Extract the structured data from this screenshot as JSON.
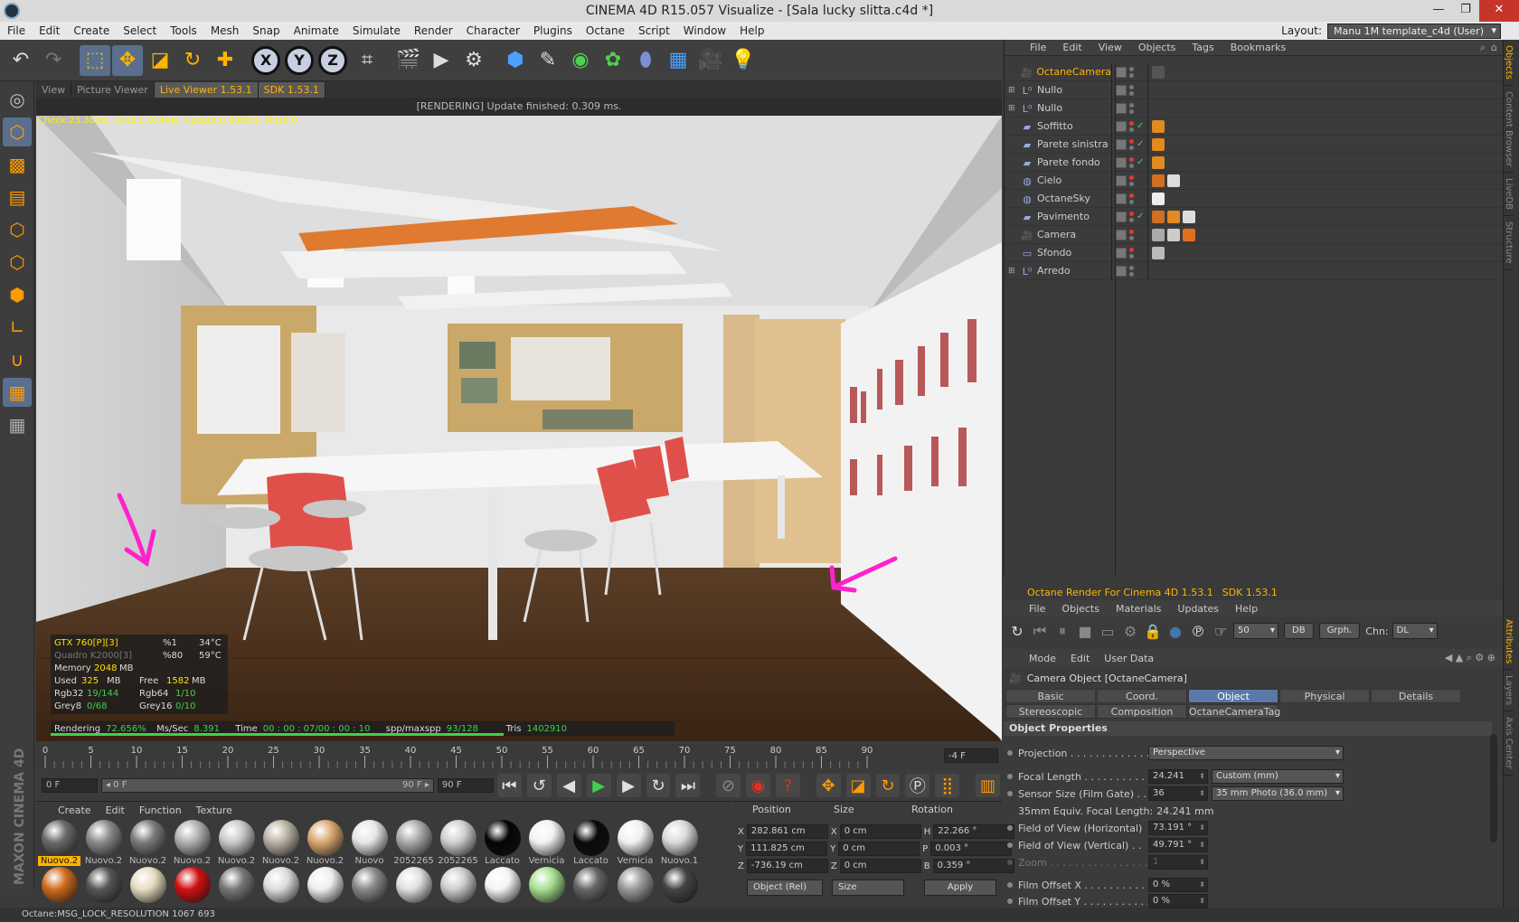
{
  "window": {
    "title": "CINEMA 4D R15.057 Visualize - [Sala lucky slitta.c4d *]",
    "min": "—",
    "restore": "❐",
    "close": "✕"
  },
  "menu": [
    "File",
    "Edit",
    "Create",
    "Select",
    "Tools",
    "Mesh",
    "Snap",
    "Animate",
    "Simulate",
    "Render",
    "Character",
    "Plugins",
    "Octane",
    "Script",
    "Window",
    "Help"
  ],
  "layout": {
    "label": "Layout:",
    "value": "Manu 1M template_c4d (User)"
  },
  "viewport": {
    "tabs": [
      "View",
      "Picture Viewer",
      "Live Viewer 1.53.1",
      "SDK 1.53.1"
    ],
    "status": "[RENDERING] Update finished: 0.309 ms.",
    "stats_line": "Check:23.38ms. Data:0.034ms. Update:0.309ms. Mesh:0",
    "gpu": {
      "gpu1": "GTX 760[P][3]",
      "gpu1_pct": "%1",
      "gpu1_temp": "34°C",
      "gpu2": "Quadro K2000[3]",
      "gpu2_pct": "%80",
      "gpu2_temp": "59°C",
      "memory_label": "Memory",
      "memory": "2048",
      "mb": "MB",
      "used_label": "Used",
      "used": "325",
      "free_label": "Free",
      "free": "1582",
      "rgb32_label": "Rgb32",
      "rgb32": "19/144",
      "rgb64_label": "Rgb64",
      "rgb64": "1/10",
      "grey8_label": "Grey8",
      "grey8": "0/68",
      "grey16_label": "Grey16",
      "grey16": "0/10"
    },
    "render": {
      "label": "Rendering",
      "pct": "72.656%",
      "mss_label": "Ms/Sec",
      "mss": "8.391",
      "time_label": "Time",
      "time": "00 : 00 : 07/00 : 00 : 10",
      "spp_label": "spp/maxspp",
      "spp": "93/128",
      "tris_label": "Tris",
      "tris": "1402910",
      "progress": 0.72656
    }
  },
  "timeline": {
    "ticks": [
      "0",
      "5",
      "10",
      "15",
      "20",
      "25",
      "30",
      "35",
      "40",
      "45",
      "50",
      "55",
      "60",
      "65",
      "70",
      "75",
      "80",
      "85",
      "90"
    ],
    "frame": "-4 F"
  },
  "transport": {
    "start": "0 F",
    "range_start": "◂ 0 F",
    "range_end": "90 F ▸",
    "end": "90 F"
  },
  "materials": {
    "menu": [
      "Create",
      "Edit",
      "Function",
      "Texture"
    ],
    "items": [
      {
        "label": "Nuovo.2",
        "color": "#6a6a6a"
      },
      {
        "label": "Nuovo.2",
        "color": "#8a8a8a"
      },
      {
        "label": "Nuovo.2",
        "color": "#7a7a7a"
      },
      {
        "label": "Nuovo.2",
        "color": "#b0b0b0"
      },
      {
        "label": "Nuovo.2",
        "color": "#c8c8c8"
      },
      {
        "label": "Nuovo.2",
        "color": "#b9b2a5"
      },
      {
        "label": "Nuovo.2",
        "color": "#d9a870"
      },
      {
        "label": "Nuovo",
        "color": "#e6e6e6"
      },
      {
        "label": "2052265",
        "color": "#a9a9a9"
      },
      {
        "label": "2052265",
        "color": "#cfcfcf"
      },
      {
        "label": "Laccato",
        "color": "#050505"
      },
      {
        "label": "Vernicia",
        "color": "#f2f2f2"
      },
      {
        "label": "Laccato",
        "color": "#0a0a0a"
      },
      {
        "label": "Vernicia",
        "color": "#f0f0f0"
      },
      {
        "label": "Nuovo.1",
        "color": "#dadada"
      },
      {
        "label": "",
        "color": "#d06a1a"
      },
      {
        "label": "",
        "color": "#555"
      },
      {
        "label": "",
        "color": "#e6dcc0"
      },
      {
        "label": "",
        "color": "#d01010"
      },
      {
        "label": "",
        "color": "#777"
      },
      {
        "label": "",
        "color": "#ddd"
      },
      {
        "label": "",
        "color": "#eee"
      },
      {
        "label": "",
        "color": "#888"
      },
      {
        "label": "",
        "color": "#e0e0e0"
      },
      {
        "label": "",
        "color": "#ccc"
      },
      {
        "label": "",
        "color": "#f4f4f4"
      },
      {
        "label": "",
        "color": "#a6e090"
      },
      {
        "label": "",
        "color": "#666"
      },
      {
        "label": "",
        "color": "#999"
      },
      {
        "label": "",
        "color": "#444"
      }
    ]
  },
  "coords": {
    "headers": {
      "position": "Position",
      "size": "Size",
      "rotation": "Rotation"
    },
    "rows": [
      {
        "axis": "X",
        "pos": "282.861 cm",
        "saxis": "X",
        "size": "0 cm",
        "raxis": "H",
        "rot": "22.266 °"
      },
      {
        "axis": "Y",
        "pos": "111.825 cm",
        "saxis": "Y",
        "size": "0 cm",
        "raxis": "P",
        "rot": "0.003 °"
      },
      {
        "axis": "Z",
        "pos": "-736.19 cm",
        "saxis": "Z",
        "size": "0 cm",
        "raxis": "B",
        "rot": "0.359 °"
      }
    ],
    "mode": "Object (Rel)",
    "size_mode": "Size",
    "apply": "Apply"
  },
  "statusbar": "Octane:MSG_LOCK_RESOLUTION 1067 693",
  "objects": {
    "menu": [
      "File",
      "Edit",
      "View",
      "Objects",
      "Tags",
      "Bookmarks"
    ],
    "items": [
      {
        "name": "OctaneCamera",
        "icon": "camera-icon",
        "sel": true,
        "expand": "",
        "check": ""
      },
      {
        "name": "Nullo",
        "icon": "null-icon",
        "expand": "⊞",
        "check": ""
      },
      {
        "name": "Nullo",
        "icon": "null-icon",
        "expand": "⊞",
        "check": ""
      },
      {
        "name": "Soffitto",
        "icon": "plane-icon",
        "expand": "",
        "check": "✓"
      },
      {
        "name": "Parete sinistra",
        "icon": "plane-icon",
        "expand": "",
        "check": "✓"
      },
      {
        "name": "Parete fondo",
        "icon": "plane-icon",
        "expand": "",
        "check": "✓"
      },
      {
        "name": "Cielo",
        "icon": "sky-icon",
        "expand": "",
        "check": ""
      },
      {
        "name": "OctaneSky",
        "icon": "sky-icon",
        "expand": "",
        "check": ""
      },
      {
        "name": "Pavimento",
        "icon": "plane-icon",
        "expand": "",
        "check": "✓"
      },
      {
        "name": "Camera",
        "icon": "camera-icon",
        "expand": "",
        "check": ""
      },
      {
        "name": "Sfondo",
        "icon": "background-icon",
        "expand": "",
        "check": ""
      },
      {
        "name": "Arredo",
        "icon": "null-icon",
        "expand": "⊞",
        "check": ""
      }
    ]
  },
  "right_tabs": [
    "Objects",
    "Content Browser",
    "LiveDB",
    "Structure",
    "Attributes",
    "Layers",
    "Axis Center"
  ],
  "octane": {
    "title": "Octane Render For Cinema 4D 1.53.1",
    "sdk": "SDK 1.53.1",
    "menu": [
      "File",
      "Objects",
      "Materials",
      "Updates",
      "Help"
    ],
    "samples": "50",
    "db": "DB",
    "graph": "Grph.",
    "chn_label": "Chn:",
    "chn": "DL"
  },
  "attributes": {
    "menu": [
      "Mode",
      "Edit",
      "User Data"
    ],
    "title": "Camera Object [OctaneCamera]",
    "tabs_row1": [
      "Basic",
      "Coord.",
      "Object",
      "Physical",
      "Details"
    ],
    "tabs_row2": [
      "Stereoscopic",
      "Composition",
      "OctaneCameraTag"
    ],
    "active_tab": "Object",
    "section": "Object Properties",
    "projection_label": "Projection . . . . . . . . . . . . .",
    "projection": "Perspective",
    "focal_label": "Focal Length . . . . . . . . . . .",
    "focal": "24.241",
    "focal_unit": "Custom (mm)",
    "sensor_label": "Sensor Size (Film Gate) . . .",
    "sensor": "36",
    "sensor_preset": "35 mm Photo (36.0 mm)",
    "equiv_label": "35mm Equiv. Focal Length:",
    "equiv": "24.241 mm",
    "fovh_label": "Field of View (Horizontal)",
    "fovh": "73.191 °",
    "fovv_label": "Field of View (Vertical) . .",
    "fovv": "49.791 °",
    "zoom_label": "Zoom . . . . . . . . . . . . . . . .",
    "zoom": "1",
    "offx_label": "Film Offset X . . . . . . . . . . .",
    "offx": "0 %",
    "offy_label": "Film Offset Y . . . . . . . . . . .",
    "offy": "0 %"
  }
}
